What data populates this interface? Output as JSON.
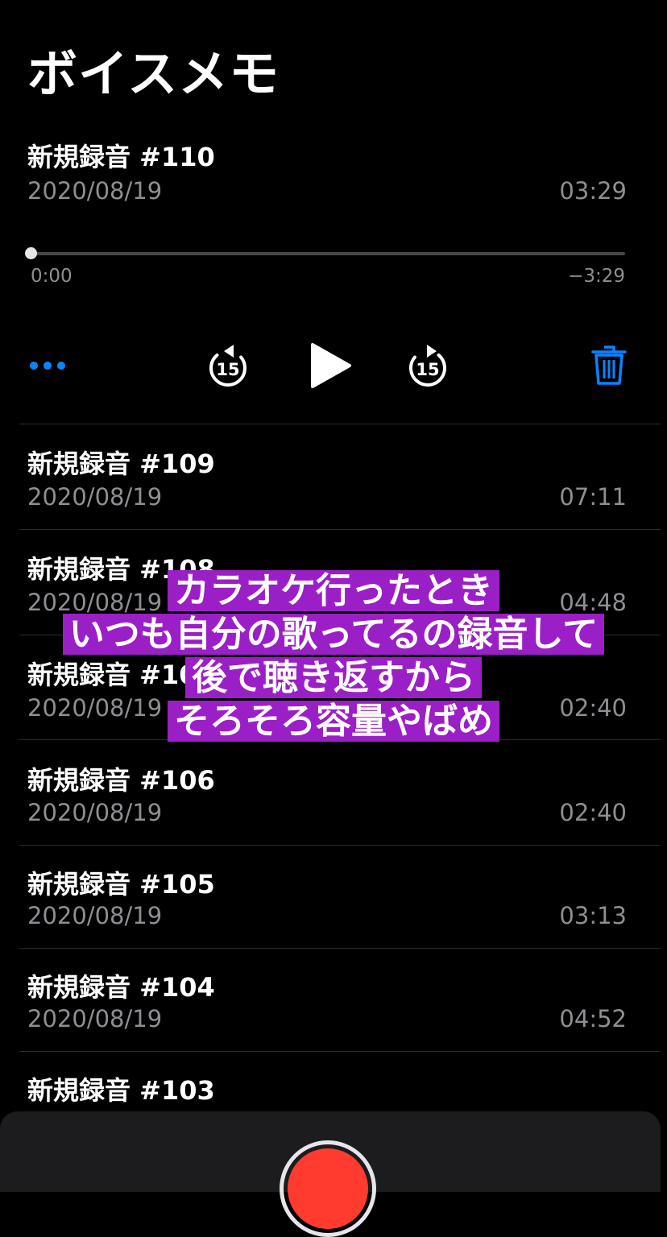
{
  "app": {
    "title": "ボイスメモ"
  },
  "current": {
    "name": "新規録音 #110",
    "date": "2020/08/19",
    "duration": "03:29",
    "elapsed": "0:00",
    "remaining": "−3:29",
    "progress": 0
  },
  "controls": {
    "more_icon": "ellipsis-icon",
    "skip_back_label": "15",
    "skip_forward_label": "15",
    "play_icon": "play-icon",
    "delete_icon": "trash-icon",
    "accent": "#0a84ff"
  },
  "recordings": [
    {
      "name": "新規録音 #109",
      "date": "2020/08/19",
      "duration": "07:11"
    },
    {
      "name": "新規録音 #108",
      "date": "2020/08/19",
      "duration": "04:48"
    },
    {
      "name": "新規録音 #107",
      "date": "2020/08/19",
      "duration": "02:40"
    },
    {
      "name": "新規録音 #106",
      "date": "2020/08/19",
      "duration": "02:40"
    },
    {
      "name": "新規録音 #105",
      "date": "2020/08/19",
      "duration": "03:13"
    },
    {
      "name": "新規録音 #104",
      "date": "2020/08/19",
      "duration": "04:52"
    },
    {
      "name": "新規録音 #103"
    }
  ],
  "overlay_caption": {
    "lines": [
      "カラオケ行ったとき",
      "いつも自分の歌ってるの録音して",
      "後で聴き返すから",
      "そろそろ容量やばめ"
    ],
    "highlight_color": "#9b1fc6"
  },
  "record_button": {
    "icon": "record-icon",
    "color": "#ff3b30"
  }
}
